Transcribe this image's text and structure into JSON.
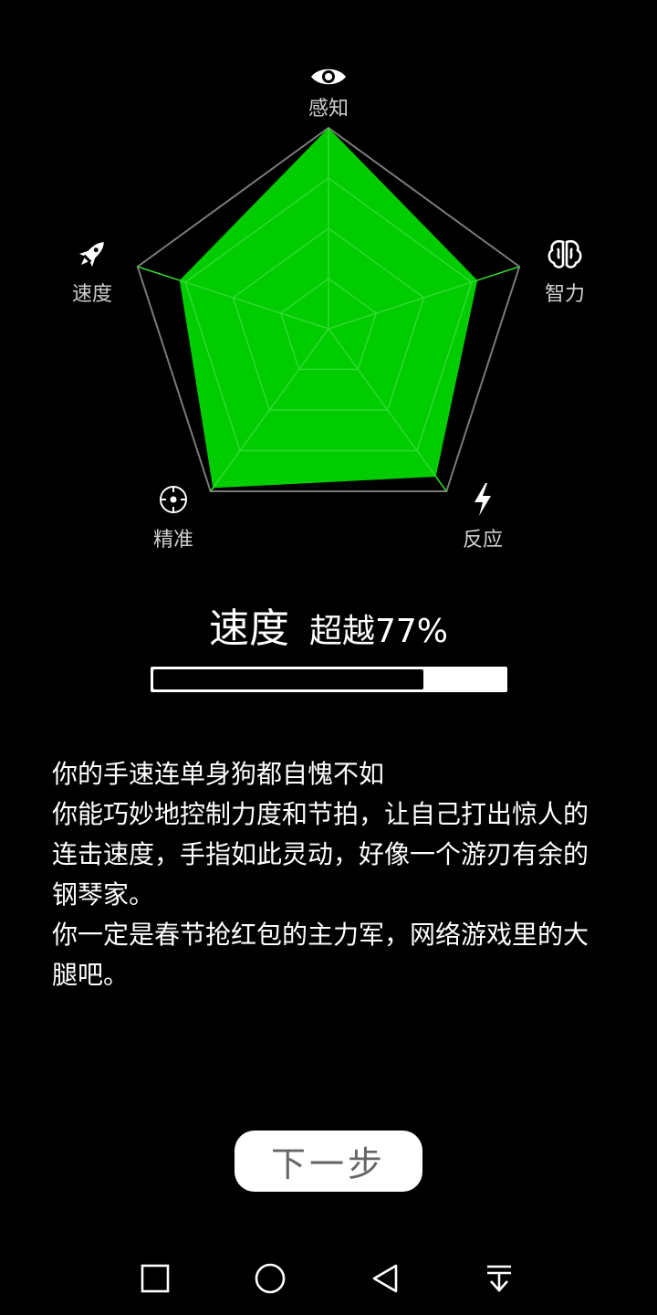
{
  "radar": {
    "axes": [
      {
        "key": "perception",
        "label": "感知",
        "icon": "eye-icon",
        "value": 1.0
      },
      {
        "key": "intelligence",
        "label": "智力",
        "icon": "brain-icon",
        "value": 0.78
      },
      {
        "key": "reaction",
        "label": "反应",
        "icon": "lightning-icon",
        "value": 0.91
      },
      {
        "key": "precision",
        "label": "精准",
        "icon": "crosshair-icon",
        "value": 0.98
      },
      {
        "key": "speed",
        "label": "速度",
        "icon": "rocket-icon",
        "value": 0.78
      }
    ],
    "rings": 4,
    "fill_color": "#00cc00",
    "grid_color": "#7a7a7a"
  },
  "result": {
    "skill": "速度",
    "surpass_label": "超越",
    "surpass_value": "77%",
    "progress": 0.77
  },
  "description": [
    "你的手速连单身狗都自愧不如",
    "你能巧妙地控制力度和节拍，让自己打出惊人的连击速度，手指如此灵动，好像一个游刃有余的钢琴家。",
    "你一定是春节抢红包的主力军，网络游戏里的大腿吧。"
  ],
  "next_button": "下一步",
  "nav": {
    "icons": [
      "recent-apps-icon",
      "home-icon",
      "back-icon",
      "notification-pull-icon"
    ]
  }
}
